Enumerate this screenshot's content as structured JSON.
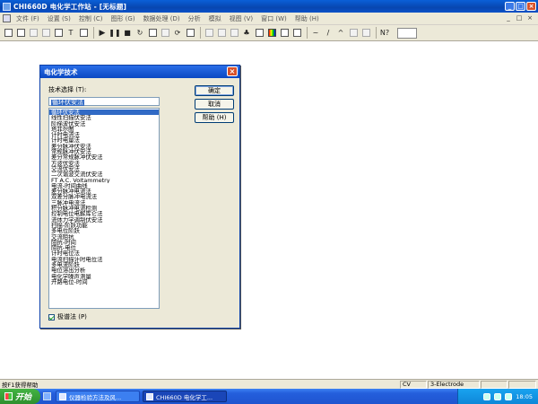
{
  "window": {
    "title": "CHI660D 电化学工作站 - [无标题]",
    "controls": {
      "minimize": "_",
      "maximize": "□",
      "close": "×"
    }
  },
  "menu": {
    "items": [
      "文件 (F)",
      "设置 (S)",
      "控制 (C)",
      "图形 (G)",
      "数据处理 (D)",
      "分析",
      "模拟",
      "视图 (V)",
      "窗口 (W)",
      "帮助 (H)"
    ],
    "mdi_controls": {
      "minimize": "_",
      "restore": "□",
      "close": "×"
    }
  },
  "toolbar": {
    "items": [
      "new-icon",
      "open-icon",
      "save-icon",
      "print-icon",
      "technique-icon",
      "text-icon",
      "parameters-icon",
      "run-icon",
      "pause-icon",
      "stop-icon",
      "reverse-icon",
      "cell-icon",
      "filter-icon",
      "rotate-icon",
      "macro-icon",
      "zoom-icon",
      "overlay-icon",
      "add-icon",
      "graph-icon",
      "color-icon",
      "settings-icon",
      "smooth-icon",
      "derivative-icon",
      "integrate-icon",
      "peak-icon",
      "blank-icon",
      "help-icon"
    ]
  },
  "dialog": {
    "title": "电化学技术",
    "close": "×",
    "select_label": "技术选择 (T):",
    "selected_value": "循环伏安法",
    "techniques": [
      "循环伏安法",
      "线性扫描伏安法",
      "阶梯波伏安法",
      "塔菲尔图",
      "计时电流法",
      "计时电量法",
      "差分脉冲伏安法",
      "常规脉冲伏安法",
      "差分常规脉冲伏安法",
      "方波伏安法",
      "交流伏安法",
      "二次谐波交流伏安法",
      "FT A.C. Voltammetry",
      "电流-时间曲线",
      "差分脉冲电流法",
      "双差分脉冲电流法",
      "三脉冲电流法",
      "积分脉冲电流检测",
      "控制电位电解库仑法",
      "流体力学调制伏安法",
      "扫描-阶跃功能",
      "多电位阶跃",
      "交流阻抗",
      "阻抗-时间",
      "阻抗-电位",
      "计时电位法",
      "电流扫描计时电位法",
      "多电流阶跃",
      "电位溶出分析",
      "电化学噪声测量",
      "开路电位-时间"
    ],
    "selected_index": 0,
    "buttons": {
      "ok": "确定",
      "cancel": "取消",
      "help": "帮助 (H)"
    },
    "checkbox": {
      "label": "极谱法 (P)",
      "checked": true
    }
  },
  "statusbar": {
    "message": "按F1获得帮助",
    "panel_cv": "CV",
    "panel_electrode": "3-Electrode"
  },
  "taskbar": {
    "start_label": "开始",
    "tasks": [
      {
        "label": "仪器检验方法及风...",
        "active": false
      },
      {
        "label": "CHI660D 电化学工...",
        "active": true
      }
    ],
    "clock": "18:05"
  }
}
